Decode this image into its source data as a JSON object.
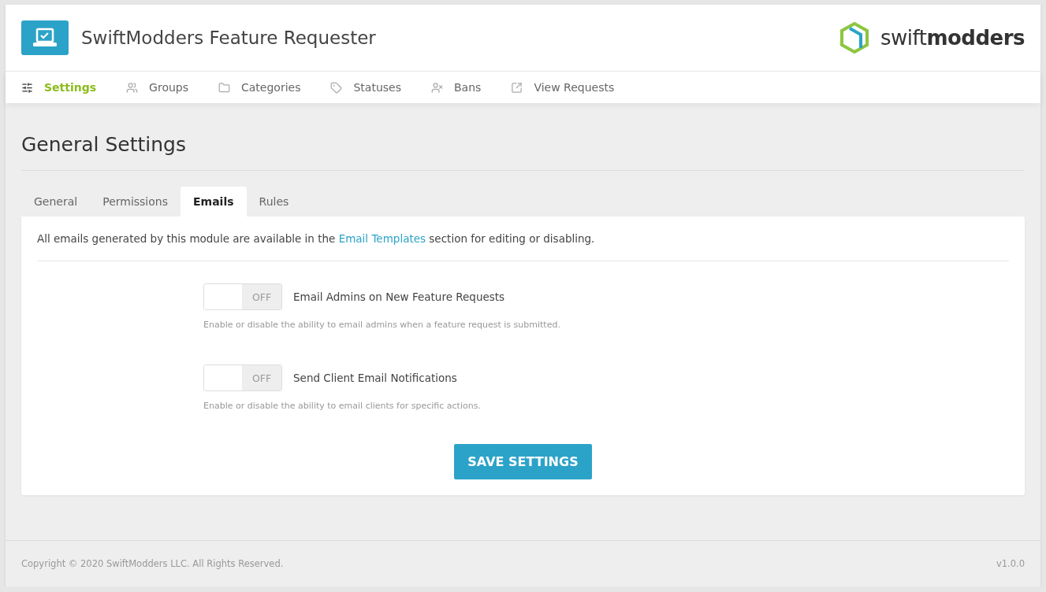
{
  "header": {
    "title": "SwiftModders Feature Requester",
    "logo_text": "swift**modders**"
  },
  "nav": [
    {
      "label": "Settings",
      "selected": true
    },
    {
      "label": "Groups",
      "selected": false
    },
    {
      "label": "Categories",
      "selected": false
    },
    {
      "label": "Statuses",
      "selected": false
    },
    {
      "label": "Bans",
      "selected": false
    },
    {
      "label": "View Requests",
      "selected": false
    }
  ],
  "page_title": "General Settings",
  "tabs": [
    {
      "label": "General",
      "selected": false
    },
    {
      "label": "Permissions",
      "selected": false
    },
    {
      "label": "Emails",
      "selected": true
    },
    {
      "label": "Rules",
      "selected": false
    }
  ],
  "notice": {
    "before": "All emails generated by this module are available in the ",
    "link": "Email Templates",
    "after": " section for editing or disabling."
  },
  "settings": [
    {
      "label": "Email Admins on New Feature Requests",
      "on": false,
      "state_text": "OFF",
      "help": "Enable or disable the ability to email admins when a feature request is submitted."
    },
    {
      "label": "Send Client Email Notifications",
      "on": false,
      "state_text": "OFF",
      "help": "Enable or disable the ability to email clients for specific actions."
    }
  ],
  "save_button": "SAVE SETTINGS",
  "footer": {
    "copyright": "Copyright © 2020 SwiftModders LLC. All Rights Reserved.",
    "version": "v1.0.0"
  }
}
